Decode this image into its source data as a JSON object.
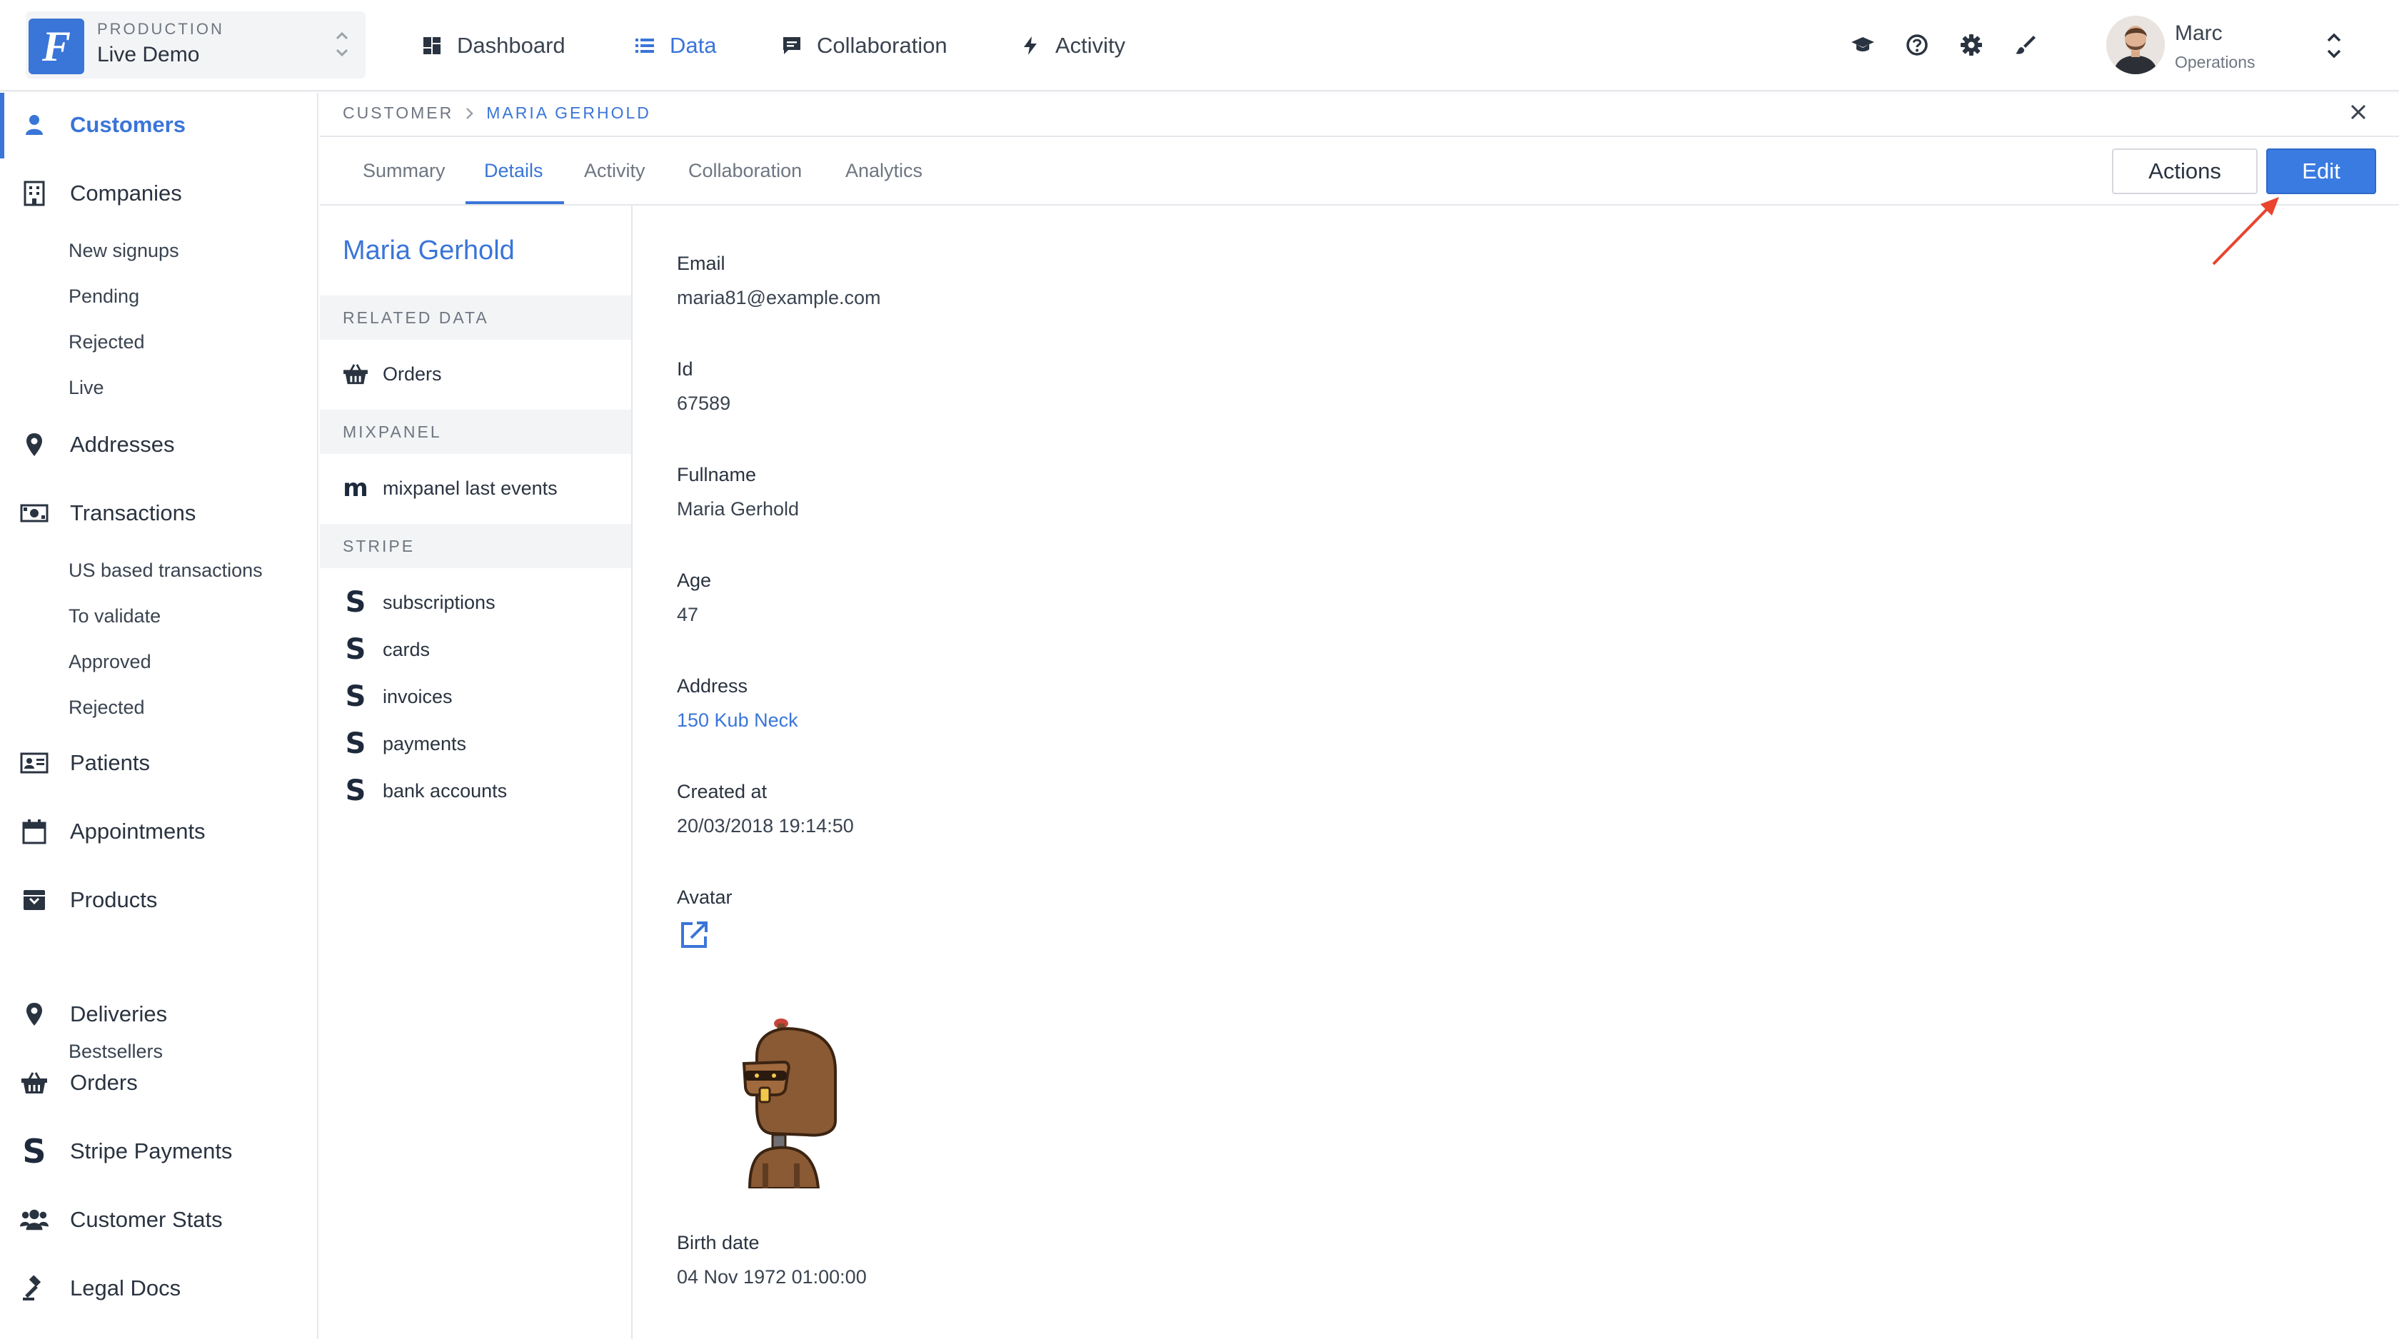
{
  "project": {
    "environment": "PRODUCTION",
    "name": "Live Demo",
    "logo_letter": "F"
  },
  "nav": [
    {
      "label": "Dashboard",
      "icon": "dashboard-icon"
    },
    {
      "label": "Data",
      "icon": "list-icon",
      "active": true
    },
    {
      "label": "Collaboration",
      "icon": "message-icon"
    },
    {
      "label": "Activity",
      "icon": "bolt-icon"
    }
  ],
  "top_icons": [
    "graduation-cap-icon",
    "help-icon",
    "gear-icon",
    "brush-icon"
  ],
  "user": {
    "name": "Marc",
    "role": "Operations"
  },
  "sidebar": {
    "items": [
      {
        "label": "Customers",
        "icon": "person-icon",
        "active": true
      },
      {
        "label": "Companies",
        "icon": "building-icon"
      },
      {
        "label": "New signups",
        "sub": true
      },
      {
        "label": "Pending",
        "sub": true
      },
      {
        "label": "Rejected",
        "sub": true
      },
      {
        "label": "Live",
        "sub": true
      },
      {
        "label": "Addresses",
        "icon": "map-pin-icon"
      },
      {
        "label": "Transactions",
        "icon": "banknote-icon"
      },
      {
        "label": "US based transactions",
        "sub": true
      },
      {
        "label": "To validate",
        "sub": true
      },
      {
        "label": "Approved",
        "sub": true
      },
      {
        "label": "Rejected",
        "sub": true
      },
      {
        "label": "Patients",
        "icon": "id-card-icon"
      },
      {
        "label": "Appointments",
        "icon": "calendar-icon"
      },
      {
        "label": "Products",
        "icon": "archive-icon"
      },
      {
        "label": "Bestsellers",
        "sub": true
      },
      {
        "label": "Deliveries",
        "icon": "map-pin-icon"
      },
      {
        "label": "Orders",
        "icon": "basket-icon"
      },
      {
        "label": "Stripe Payments",
        "icon": "stripe-icon"
      },
      {
        "label": "Customer Stats",
        "icon": "users-icon"
      },
      {
        "label": "Legal Docs",
        "icon": "gavel-icon"
      }
    ]
  },
  "breadcrumb": {
    "root": "CUSTOMER",
    "current": "MARIA GERHOLD"
  },
  "tabs": [
    {
      "label": "Summary"
    },
    {
      "label": "Details",
      "active": true
    },
    {
      "label": "Activity"
    },
    {
      "label": "Collaboration"
    },
    {
      "label": "Analytics"
    }
  ],
  "actions": {
    "actions_label": "Actions",
    "edit_label": "Edit"
  },
  "related": {
    "title": "Maria Gerhold",
    "sections": [
      {
        "header": "RELATED DATA",
        "items": [
          {
            "label": "Orders",
            "icon": "basket-icon"
          }
        ]
      },
      {
        "header": "MIXPANEL",
        "items": [
          {
            "label": "mixpanel last events",
            "icon": "mixpanel-icon"
          }
        ]
      },
      {
        "header": "STRIPE",
        "items": [
          {
            "label": "subscriptions",
            "icon": "stripe-icon"
          },
          {
            "label": "cards",
            "icon": "stripe-icon"
          },
          {
            "label": "invoices",
            "icon": "stripe-icon"
          },
          {
            "label": "payments",
            "icon": "stripe-icon"
          },
          {
            "label": "bank accounts",
            "icon": "stripe-icon"
          }
        ]
      }
    ]
  },
  "details": [
    {
      "label": "Email",
      "value": "maria81@example.com"
    },
    {
      "label": "Id",
      "value": "67589"
    },
    {
      "label": "Fullname",
      "value": "Maria Gerhold"
    },
    {
      "label": "Age",
      "value": "47"
    },
    {
      "label": "Address",
      "value": "150 Kub Neck",
      "link": true
    },
    {
      "label": "Created at",
      "value": "20/03/2018 19:14:50"
    },
    {
      "label": "Avatar",
      "value": ""
    },
    {
      "label": "Birth date",
      "value": "04 Nov 1972 01:00:00"
    }
  ],
  "colors": {
    "accent": "#3a75d8",
    "edit_button": "#3a7be2",
    "annotation_arrow": "#e8442e"
  }
}
